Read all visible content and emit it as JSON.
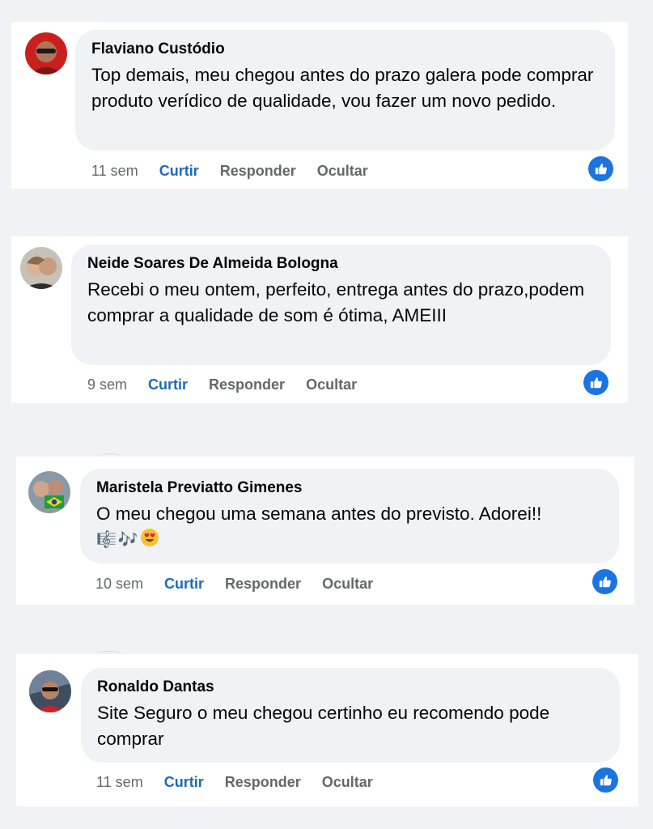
{
  "comments": [
    {
      "author": "Flaviano Custódio",
      "text": "Top demais, meu chegou antes do prazo galera pode comprar produto verídico de qualidade, vou fazer um novo pedido.",
      "time": "11 sem",
      "like_label": "Curtir",
      "reply_label": "Responder",
      "hide_label": "Ocultar"
    },
    {
      "author": "Neide Soares De Almeida Bologna",
      "text": "Recebi o meu ontem, perfeito, entrega antes do prazo,podem comprar a qualidade de som é ótima, AMEIII",
      "time": "9 sem",
      "like_label": "Curtir",
      "reply_label": "Responder",
      "hide_label": "Ocultar"
    },
    {
      "author": "Maristela Previatto Gimenes",
      "text": "O meu chegou uma semana antes do previsto. Adorei!!",
      "emojis": [
        "🎼",
        "🎶",
        "😍"
      ],
      "time": "10 sem",
      "like_label": "Curtir",
      "reply_label": "Responder",
      "hide_label": "Ocultar"
    },
    {
      "author": "Ronaldo Dantas",
      "text": "Site Seguro o meu chegou certinho eu recomendo pode comprar",
      "time": "11 sem",
      "like_label": "Curtir",
      "reply_label": "Responder",
      "hide_label": "Ocultar"
    }
  ],
  "icons": {
    "reaction": "like-thumbs-up-icon",
    "avatar": "avatar"
  },
  "colors": {
    "like_accent": "#1b6bb8",
    "badge_blue": "#1b74e4",
    "bubble": "#f0f2f5",
    "muted_text": "#65676b"
  }
}
